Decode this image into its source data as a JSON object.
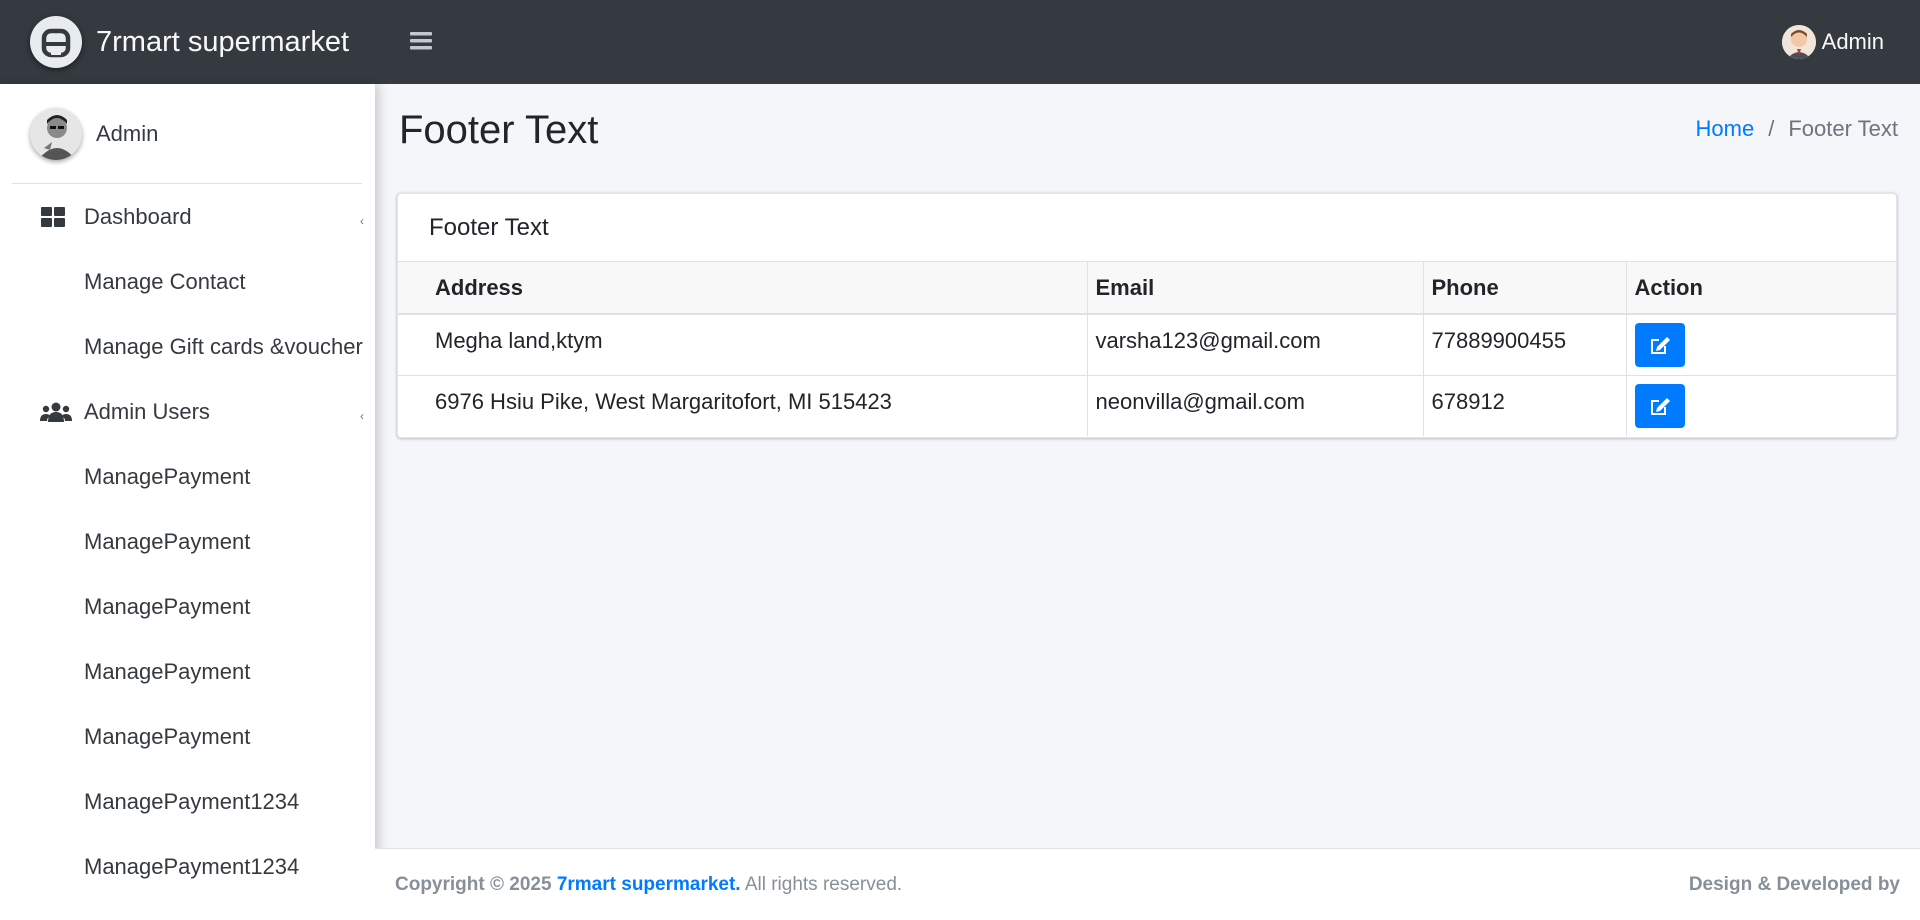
{
  "brand": {
    "name": "7rmart supermarket",
    "logo_icon": "rounded-square-logo-icon"
  },
  "topbar": {
    "menu_icon": "hamburger-icon",
    "user_name": "Admin"
  },
  "sidebar": {
    "user_name": "Admin",
    "items": [
      {
        "label": "Dashboard",
        "icon": "dashboard-grid-icon",
        "has_arrow": true
      },
      {
        "label": "Manage Contact",
        "icon": ""
      },
      {
        "label": "Manage Gift cards &voucher",
        "icon": ""
      },
      {
        "label": "Admin Users",
        "icon": "users-icon",
        "has_arrow": true
      },
      {
        "label": "ManagePayment",
        "icon": ""
      },
      {
        "label": "ManagePayment",
        "icon": ""
      },
      {
        "label": "ManagePayment",
        "icon": ""
      },
      {
        "label": "ManagePayment",
        "icon": ""
      },
      {
        "label": "ManagePayment",
        "icon": ""
      },
      {
        "label": "ManagePayment1234",
        "icon": ""
      },
      {
        "label": "ManagePayment1234",
        "icon": ""
      }
    ],
    "arrow_glyph": "‹"
  },
  "page": {
    "title": "Footer Text",
    "breadcrumb": {
      "home": "Home",
      "separator": "/",
      "current": "Footer Text"
    }
  },
  "card": {
    "title": "Footer Text",
    "columns": [
      "Address",
      "Email",
      "Phone",
      "Action"
    ],
    "rows": [
      {
        "address": "Megha land,ktym",
        "email": "varsha123@gmail.com",
        "phone": "77889900455",
        "action_icon": "edit-icon"
      },
      {
        "address": "6976 Hsiu Pike, West Margaritofort, MI 515423",
        "email": "neonvilla@gmail.com",
        "phone": "678912",
        "action_icon": "edit-icon"
      }
    ]
  },
  "footer": {
    "copyright_prefix": "Copyright © 2025",
    "brand": "7rmart supermarket.",
    "rights": "All rights reserved.",
    "right_text": "Design & Developed by"
  },
  "colors": {
    "navbar": "#343a40",
    "primary": "#007bff",
    "background": "#f4f6f9"
  }
}
